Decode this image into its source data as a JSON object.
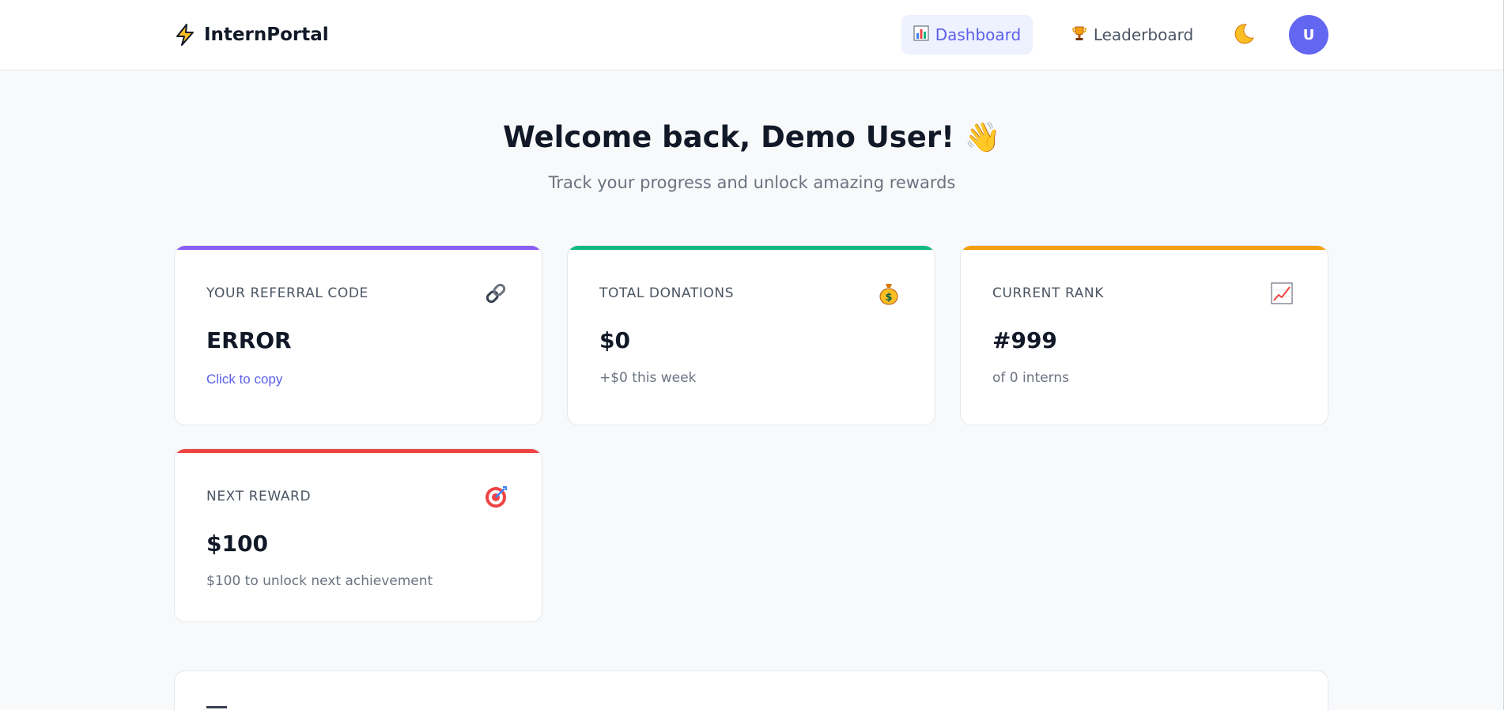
{
  "app": {
    "brand": "InternPortal",
    "brand_icon": "lightning-bolt-icon"
  },
  "nav": {
    "dashboard_label": "Dashboard",
    "dashboard_icon": "bar-chart-icon",
    "leaderboard_label": "Leaderboard",
    "leaderboard_icon": "trophy-icon",
    "theme_icon": "moon-icon",
    "avatar_initial": "U"
  },
  "hero": {
    "title": "Welcome back, Demo User! 👋",
    "subtitle": "Track your progress and unlock amazing rewards"
  },
  "cards": [
    {
      "label": "YOUR REFERRAL CODE",
      "value": "ERROR",
      "action": "Click to copy",
      "icon": "link-icon",
      "accent": "#8b5cf6"
    },
    {
      "label": "TOTAL DONATIONS",
      "value": "$0",
      "sub": "+$0 this week",
      "icon": "money-bag-icon",
      "accent": "#10b981"
    },
    {
      "label": "CURRENT RANK",
      "value": "#999",
      "sub": "of 0 interns",
      "icon": "trending-chart-icon",
      "accent": "#f59e0b"
    },
    {
      "label": "NEXT REWARD",
      "value": "$100",
      "sub": "$100 to unlock next achievement",
      "icon": "target-icon",
      "accent": "#ef4444"
    }
  ],
  "colors": {
    "primary": "#6366f1",
    "nav_active_bg": "#eef2ff",
    "page_bg": "#f8f9fa"
  }
}
